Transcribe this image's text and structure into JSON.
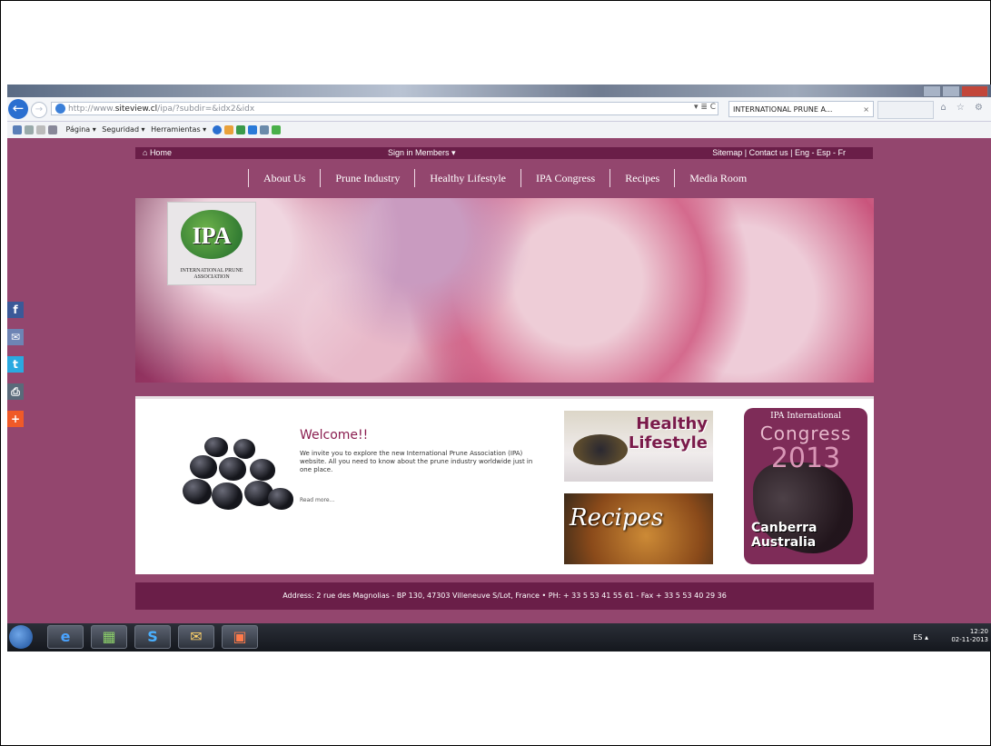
{
  "browser": {
    "url_prefix": "http://www.",
    "url_host": "siteview.cl",
    "url_path": "/ipa/?subdir=&idx2&idx",
    "url_controls": "▾ ≣ C",
    "tab_title": "INTERNATIONAL PRUNE A...",
    "tab_close": "×",
    "right_icons": "⌂ ☆ ⚙",
    "back_glyph": "←",
    "forward_glyph": "→",
    "menu": {
      "pagina": "Página ▾",
      "seguridad": "Seguridad ▾",
      "herramientas": "Herramientas ▾"
    }
  },
  "site": {
    "topbar": {
      "home": "Home",
      "sign_in": "Sign in Members",
      "right_links": "Sitemap | Contact us | Eng - Esp - Fr"
    },
    "nav": [
      "About Us",
      "Prune Industry",
      "Healthy Lifestyle",
      "IPA Congress",
      "Recipes",
      "Media Room"
    ],
    "logo": {
      "letters": "IPA",
      "name": "INTERNATIONAL PRUNE ASSOCIATION"
    },
    "welcome": {
      "title": "Welcome!!",
      "text": "We invite you to explore the new International Prune Association (IPA) website. All you need to know about the prune industry worldwide just in one place.",
      "read_more": "Read more..."
    },
    "promos": {
      "healthy": "Healthy Lifestyle",
      "recipes": "Recipes",
      "congress_line1": "IPA International",
      "congress_line2": "Congress",
      "congress_year": "2013",
      "congress_location": "Canberra Australia"
    },
    "footer": "Address: 2 rue des Magnolias - BP 130, 47303 Villeneuve S/Lot, France • PH: + 33 5 53 41 55 61 - Fax + 33 5 53 40 29 36"
  },
  "social": [
    "f",
    "✉",
    "t",
    "⎙",
    "+"
  ],
  "social_colors": [
    "#3b5998",
    "#6d84b4",
    "#2aa9e0",
    "#5a6a7a",
    "#f05a28"
  ],
  "taskbar": {
    "apps": [
      "e",
      "▦",
      "S",
      "✉",
      "▣"
    ],
    "lang": "ES",
    "time": "12:20",
    "date": "02-11-2013"
  }
}
